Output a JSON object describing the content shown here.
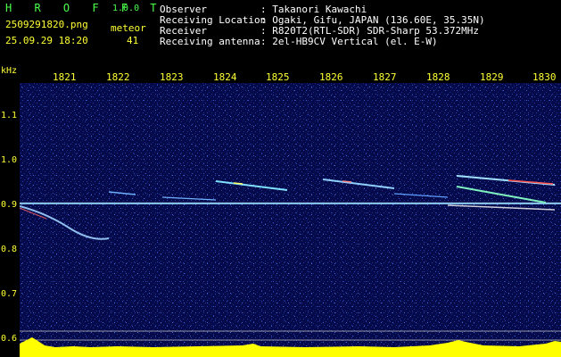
{
  "app": {
    "title": "H R O F F T",
    "version": "1.0.0"
  },
  "file": {
    "name": "2509291820.png",
    "datetime": "25.09.29 18:20"
  },
  "meteor": {
    "label": "meteor",
    "count": "41"
  },
  "info": [
    {
      "key": "Observer",
      "value": ": Takanori Kawachi"
    },
    {
      "key": "Receiving Location",
      "value": ": Ogaki, Gifu, JAPAN (136.60E, 35.35N)"
    },
    {
      "key": "Receiver",
      "value": ": R820T2(RTL-SDR) SDR-Sharp 53.372MHz"
    },
    {
      "key": "Receiving antenna",
      "value": ": 2el-HB9CV Vertical (el. E-W)"
    }
  ],
  "axis": {
    "unit": "kHz",
    "x_ticks": [
      "1821",
      "1822",
      "1823",
      "1824",
      "1825",
      "1826",
      "1827",
      "1828",
      "1829",
      "1830"
    ],
    "y_ticks": [
      "1.1",
      "1.0",
      "0.9",
      "0.8",
      "0.7",
      "0.6"
    ]
  },
  "colors": {
    "background": "#050a4a",
    "carrier": "#8fd8ff",
    "meteor_head": "#ffffff",
    "level_fill": "#ffff00",
    "level_base": "#00e0ff",
    "text_green": "#4cff4c",
    "text_yellow": "#ffff33"
  }
}
